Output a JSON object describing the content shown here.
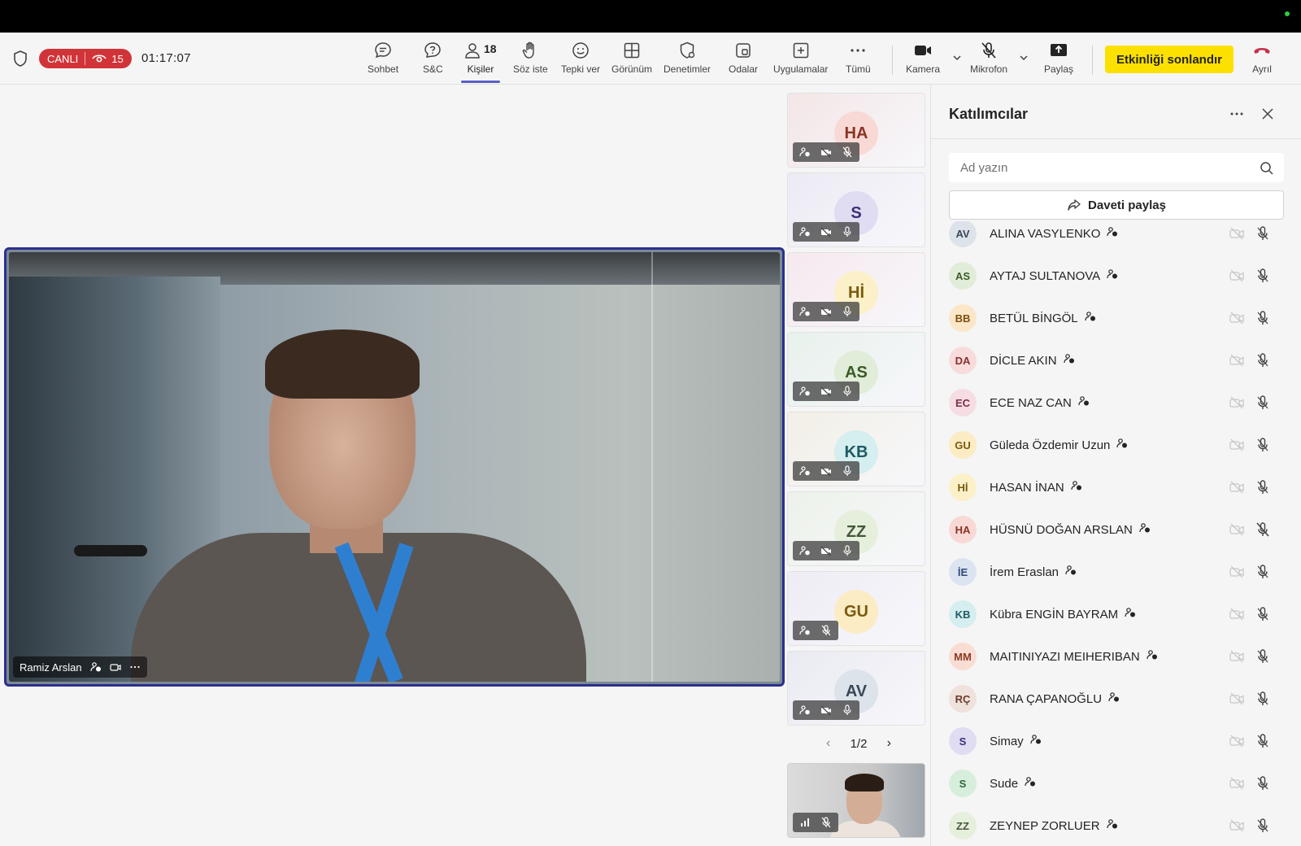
{
  "toolbar": {
    "live_label": "CANLI",
    "viewer_count": "15",
    "timer": "01:17:07",
    "people_count": "18",
    "items": [
      {
        "label": "Sohbet",
        "icon": "chat-icon"
      },
      {
        "label": "S&C",
        "icon": "qa-icon"
      },
      {
        "label": "Kişiler",
        "icon": "people-icon",
        "active": true
      },
      {
        "label": "Söz iste",
        "icon": "raise-hand-icon"
      },
      {
        "label": "Tepki ver",
        "icon": "react-icon"
      },
      {
        "label": "Görünüm",
        "icon": "view-icon"
      },
      {
        "label": "Denetimler",
        "icon": "controls-icon"
      },
      {
        "label": "Odalar",
        "icon": "rooms-icon"
      },
      {
        "label": "Uygulamalar",
        "icon": "apps-icon"
      },
      {
        "label": "Tümü",
        "icon": "more-icon"
      },
      {
        "label": "Kamera",
        "icon": "camera-icon"
      },
      {
        "label": "Mikrofon",
        "icon": "mic-off-icon"
      },
      {
        "label": "Paylaş",
        "icon": "share-icon"
      }
    ],
    "end_event_label": "Etkinliği sonlandır",
    "leave_label": "Ayrıl"
  },
  "main_video": {
    "speaker_name": "Ramiz Arslan"
  },
  "gallery": {
    "tiles": [
      {
        "initials": "HA",
        "bg": "#f3e6e6",
        "avatar_bg": "#f9d9d5",
        "color": "#8a3324"
      },
      {
        "initials": "S",
        "bg": "#ecebf4",
        "avatar_bg": "#e0dcf2",
        "color": "#3b2f7a"
      },
      {
        "initials": "Hİ",
        "bg": "#f6e9ee",
        "avatar_bg": "#fbf0c8",
        "color": "#7a5a10"
      },
      {
        "initials": "AS",
        "bg": "#e8f1ec",
        "avatar_bg": "#e1ecd9",
        "color": "#3a5c25"
      },
      {
        "initials": "KB",
        "bg": "#f2efe6",
        "avatar_bg": "#d5eef0",
        "color": "#1e5a63"
      },
      {
        "initials": "ZZ",
        "bg": "#edf2ea",
        "avatar_bg": "#e6efdc",
        "color": "#44573a"
      },
      {
        "initials": "GU",
        "bg": "#eeecf4",
        "avatar_bg": "#fbecc4",
        "color": "#7a5a10"
      },
      {
        "initials": "AV",
        "bg": "#eaeaf2",
        "avatar_bg": "#dde3ea",
        "color": "#3a4757"
      }
    ],
    "page": "1/2"
  },
  "panel": {
    "title": "Katılımcılar",
    "search_placeholder": "Ad yazın",
    "invite_label": "Daveti paylaş",
    "participants": [
      {
        "initials": "AV",
        "name": "ALINA VASYLENKO",
        "avatar_bg": "#dde3ea",
        "color": "#3a4757",
        "mic": "on"
      },
      {
        "initials": "AS",
        "name": "AYTAJ SULTANOVA",
        "avatar_bg": "#e1ecd9",
        "color": "#3a5c25",
        "mic": "on"
      },
      {
        "initials": "BB",
        "name": "BETÜL BİNGÖL",
        "avatar_bg": "#fbe7c8",
        "color": "#7a4e10",
        "mic": "on"
      },
      {
        "initials": "DA",
        "name": "DİCLE AKIN",
        "avatar_bg": "#f8dcdc",
        "color": "#8a2f2f",
        "mic": "on"
      },
      {
        "initials": "EC",
        "name": "ECE NAZ CAN",
        "avatar_bg": "#f6dde3",
        "color": "#7a2f45",
        "mic": "on"
      },
      {
        "initials": "GU",
        "name": "Güleda Özdemir Uzun",
        "avatar_bg": "#fbecc4",
        "color": "#7a5a10",
        "mic": "on"
      },
      {
        "initials": "Hİ",
        "name": "HASAN İNAN",
        "avatar_bg": "#fbf0c8",
        "color": "#7a5a10",
        "mic": "on"
      },
      {
        "initials": "HA",
        "name": "HÜSNÜ DOĞAN ARSLAN",
        "avatar_bg": "#f9d9d5",
        "color": "#8a3324",
        "mic": "off"
      },
      {
        "initials": "İE",
        "name": "İrem Eraslan",
        "avatar_bg": "#dce4f2",
        "color": "#2f4a7a",
        "mic": "on"
      },
      {
        "initials": "KB",
        "name": "Kübra ENGİN BAYRAM",
        "avatar_bg": "#d5eef0",
        "color": "#1e5a63",
        "mic": "on"
      },
      {
        "initials": "MM",
        "name": "MAITINIYAZI MEIHERIBAN",
        "avatar_bg": "#f9ddd3",
        "color": "#8a3a24",
        "mic": "on"
      },
      {
        "initials": "RÇ",
        "name": "RANA ÇAPANOĞLU",
        "avatar_bg": "#efe1dc",
        "color": "#6a3a2a",
        "mic": "on"
      },
      {
        "initials": "S",
        "name": "Simay",
        "avatar_bg": "#e0dcf2",
        "color": "#3b2f7a",
        "mic": "on"
      },
      {
        "initials": "S",
        "name": "Sude",
        "avatar_bg": "#d8eedc",
        "color": "#2f6a3a",
        "mic": "on"
      },
      {
        "initials": "ZZ",
        "name": "ZEYNEP ZORLUER",
        "avatar_bg": "#e6efdc",
        "color": "#44573a",
        "mic": "on"
      }
    ]
  },
  "colors": {
    "accent": "#5b5fc7",
    "live_red": "#d13438",
    "end_yellow": "#fce100",
    "leave_red": "#c4314b",
    "speaker_border": "#2b2f8f"
  }
}
